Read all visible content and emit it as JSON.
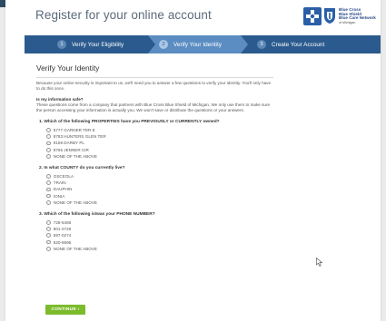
{
  "header": {
    "title": "Register for your online account",
    "logo_text": [
      "Blue Cross",
      "Blue Shield",
      "Blue Care Network"
    ],
    "logo_subtext": "of Michigan"
  },
  "steps": [
    {
      "num": "1",
      "label": "Verify Your Eligibility",
      "active": false
    },
    {
      "num": "2",
      "label": "Verify Your Identity",
      "active": true
    },
    {
      "num": "3",
      "label": "Create Your Account",
      "active": false
    }
  ],
  "main": {
    "title": "Verify Your Identity",
    "intro": "Because your online security is important to us, we'll need you to answer a few questions to verify your identity. You'll only have to do this once.",
    "safe_heading": "Is my information safe?",
    "safe_text": "These questions come from a company that partners with Blue Cross Blue Shield of Michigan. We only use them to make sure the person accessing your information is actually you. We won't save or distribute the questions or your answers."
  },
  "questions": [
    {
      "title": "1.  Which of the following PROPERTIES have you PREVIOUSLY or CURRENTLY owned?",
      "options": [
        "5777 GARNER TER E",
        "8783 HUNTERS GLEN TER",
        "9159 DARBY PL",
        "8765 JENNER CIR",
        "NONE OF THE ABOVE"
      ]
    },
    {
      "title": "2.  In what COUNTY do you currently live?",
      "options": [
        "OSCEOLA",
        "TRAIN",
        "DAUPHIN",
        "IONIA",
        "NONE OF THE ABOVE"
      ]
    },
    {
      "title": "3.  Which of the following is/was your PHONE NUMBER?",
      "options": [
        "728-6466",
        "801-2726",
        "597-0274",
        "520-6595",
        "NONE OF THE ABOVE"
      ]
    }
  ],
  "footer": {
    "continue_label": "CONTINUE ›"
  },
  "colors": {
    "stepbar": "#2b5b8e",
    "step_active": "#5b8dc2",
    "continue": "#7dbb2d",
    "title_text": "#5a6a7a"
  }
}
